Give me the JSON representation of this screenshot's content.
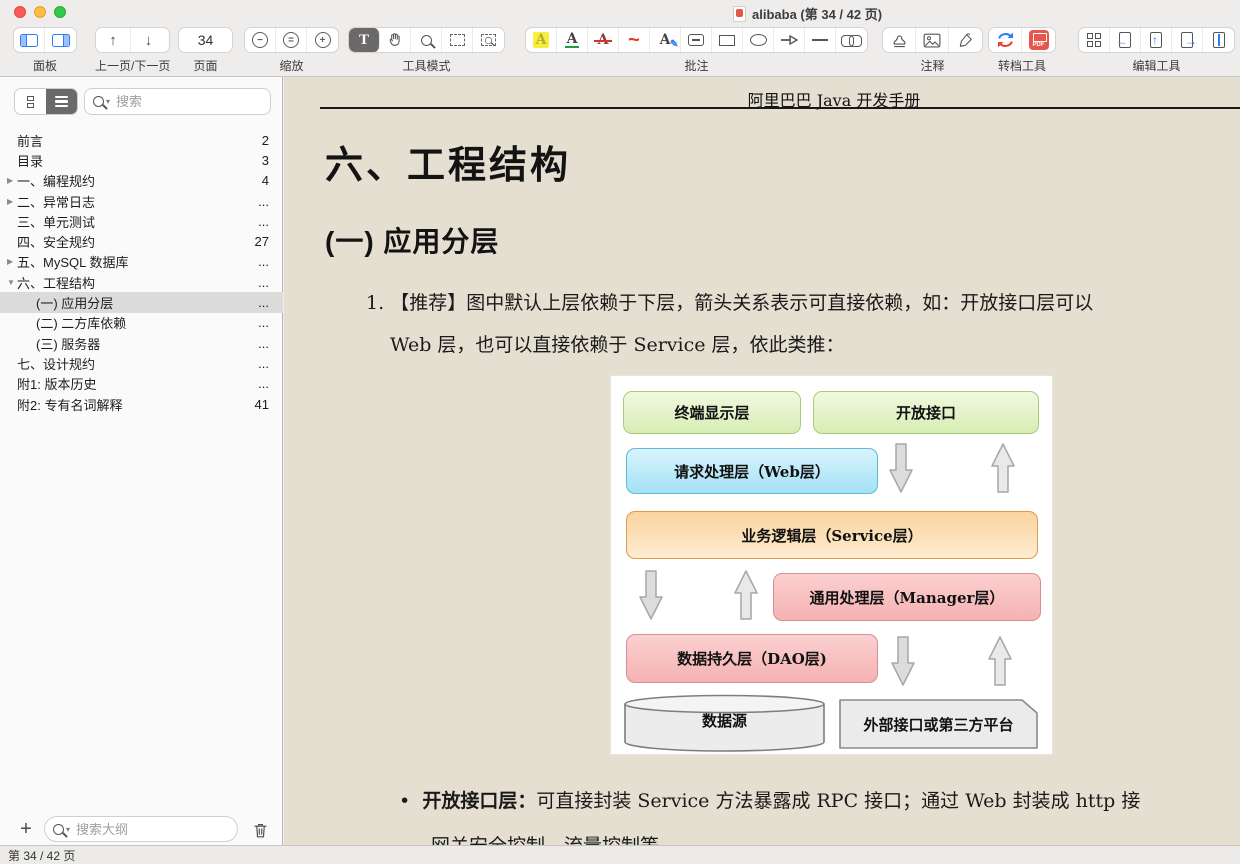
{
  "window": {
    "title": "alibaba (第 34 / 42 页)"
  },
  "toolbar": {
    "page_value": "34",
    "pdf_badge": "PDF",
    "groups": [
      {
        "label": "面板",
        "icons": [
          "panel-left-icon",
          "panel-right-icon"
        ]
      },
      {
        "label": "上一页/下一页",
        "icons": [
          "page-up-icon",
          "page-down-icon"
        ]
      },
      {
        "label": "页面"
      },
      {
        "label": "缩放",
        "icons": [
          "zoom-out-icon",
          "zoom-fit-icon",
          "zoom-in-icon"
        ]
      },
      {
        "label": "工具模式",
        "icons": [
          "text-select-icon",
          "hand-icon",
          "search-icon",
          "area-select-icon",
          "area-zoom-icon"
        ],
        "active": "text-select-icon"
      },
      {
        "label": "批注",
        "icons": [
          "highlight-icon",
          "underline-icon",
          "strikethrough-icon",
          "squiggly-icon",
          "text-correction-icon",
          "note-icon",
          "rectangle-icon",
          "ellipse-icon",
          "arrow-icon",
          "line-icon",
          "link-icon"
        ]
      },
      {
        "label": "注释",
        "icons": [
          "stamp-icon",
          "image-icon",
          "signature-icon"
        ]
      },
      {
        "label": "转档工具",
        "icons": [
          "convert-icon",
          "export-pdf-icon"
        ]
      },
      {
        "label": "编辑工具",
        "icons": [
          "organize-pages-icon",
          "insert-page-icon",
          "merge-pages-icon",
          "extract-pages-icon",
          "compress-icon"
        ]
      }
    ]
  },
  "sidebar": {
    "search_placeholder": "搜索",
    "outline_search_placeholder": "搜索大纲",
    "add_label": "+",
    "toc": [
      {
        "disclosure": "",
        "label": "前言",
        "page": "2"
      },
      {
        "disclosure": "",
        "label": "目录",
        "page": "3"
      },
      {
        "disclosure": "▶",
        "label": "一、编程规约",
        "page": "4"
      },
      {
        "disclosure": "▶",
        "label": "二、异常日志",
        "page": "..."
      },
      {
        "disclosure": "",
        "label": "三、单元测试",
        "page": "..."
      },
      {
        "disclosure": "",
        "label": "四、安全规约",
        "page": "27"
      },
      {
        "disclosure": "▶",
        "label": "五、MySQL 数据库",
        "page": "..."
      },
      {
        "disclosure": "▼",
        "label": "六、工程结构",
        "page": "..."
      },
      {
        "disclosure": "",
        "label": "(一) 应用分层",
        "page": "..."
      },
      {
        "disclosure": "",
        "label": "(二) 二方库依赖",
        "page": "..."
      },
      {
        "disclosure": "",
        "label": "(三) 服务器",
        "page": "..."
      },
      {
        "disclosure": "",
        "label": "七、设计规约",
        "page": "..."
      },
      {
        "disclosure": "",
        "label": "附1: 版本历史",
        "page": "..."
      },
      {
        "disclosure": "",
        "label": "附2: 专有名词解释",
        "page": "41"
      }
    ]
  },
  "statusbar": {
    "text": "第 34 / 42 页"
  },
  "document": {
    "page_header": "阿里巴巴 Java 开发手册",
    "h1": "六、工程结构",
    "h2": "(一) 应用分层",
    "item_number": "1.",
    "item_line1": "【推荐】图中默认上层依赖于下层，箭头关系表示可直接依赖，如：开放接口层可以",
    "item_line2": "Web 层，也可以直接依赖于 Service 层，依此类推：",
    "bullet": "•",
    "bullet_term": "开放接口层：",
    "bullet_line1": "可直接封装 Service 方法暴露成 RPC 接口；通过 Web 封装成 http 接",
    "bullet_line2": "网关安全控制、流量控制等。",
    "diagram": {
      "boxes": [
        {
          "label": "终端显示层",
          "style": "green"
        },
        {
          "label": "开放接口",
          "style": "green"
        },
        {
          "label": "请求处理层（Web层）",
          "style": "blue"
        },
        {
          "label": "业务逻辑层（Service层）",
          "style": "orange"
        },
        {
          "label": "通用处理层（Manager层）",
          "style": "pink"
        },
        {
          "label": "数据持久层（DAO层)",
          "style": "pink"
        },
        {
          "label": "数据源",
          "style": "cylinder"
        },
        {
          "label": "外部接口或第三方平台",
          "style": "gray"
        }
      ]
    }
  }
}
